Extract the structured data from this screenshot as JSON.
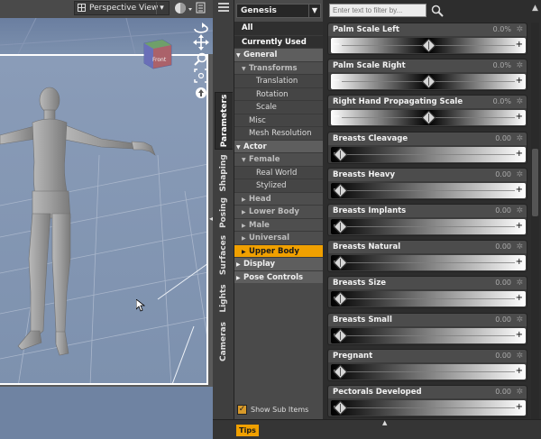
{
  "viewport": {
    "view_label": "Perspective View",
    "cube_label": "Front"
  },
  "panel": {
    "side_tabs": [
      "Parameters",
      "Shaping",
      "Posing",
      "Surfaces",
      "Lights",
      "Cameras"
    ],
    "active_tab": "Parameters",
    "figure_select": "Genesis",
    "filter_placeholder": "Enter text to filter by...",
    "tree": {
      "all": "All",
      "currently_used": "Currently Used",
      "general": "General",
      "transforms": "Transforms",
      "translation": "Translation",
      "rotation": "Rotation",
      "scale": "Scale",
      "misc": "Misc",
      "mesh_resolution": "Mesh Resolution",
      "actor": "Actor",
      "female": "Female",
      "real_world": "Real World",
      "stylized": "Stylized",
      "head": "Head",
      "lower_body": "Lower Body",
      "male": "Male",
      "universal": "Universal",
      "upper_body": "Upper Body",
      "display": "Display",
      "pose_controls": "Pose Controls"
    },
    "show_sub_items": "Show Sub Items",
    "parameters": [
      {
        "name": "Palm Scale Left",
        "value": "0.0%",
        "kind": "dual",
        "pos": 0.5
      },
      {
        "name": "Palm Scale Right",
        "value": "0.0%",
        "kind": "dual",
        "pos": 0.5
      },
      {
        "name": "Right Hand Propagating Scale",
        "value": "0.0%",
        "kind": "dual",
        "pos": 0.5
      },
      {
        "name": "Breasts Cleavage",
        "value": "0.00",
        "kind": "mono",
        "pos": 0
      },
      {
        "name": "Breasts Heavy",
        "value": "0.00",
        "kind": "mono",
        "pos": 0
      },
      {
        "name": "Breasts Implants",
        "value": "0.00",
        "kind": "mono",
        "pos": 0
      },
      {
        "name": "Breasts Natural",
        "value": "0.00",
        "kind": "mono",
        "pos": 0
      },
      {
        "name": "Breasts Size",
        "value": "0.00",
        "kind": "mono",
        "pos": 0
      },
      {
        "name": "Breasts Small",
        "value": "0.00",
        "kind": "mono",
        "pos": 0
      },
      {
        "name": "Pregnant",
        "value": "0.00",
        "kind": "mono",
        "pos": 0
      },
      {
        "name": "Pectorals Developed",
        "value": "0.00",
        "kind": "mono",
        "pos": 0
      }
    ],
    "tips": "Tips",
    "colors": {
      "accent": "#f0a000"
    }
  }
}
